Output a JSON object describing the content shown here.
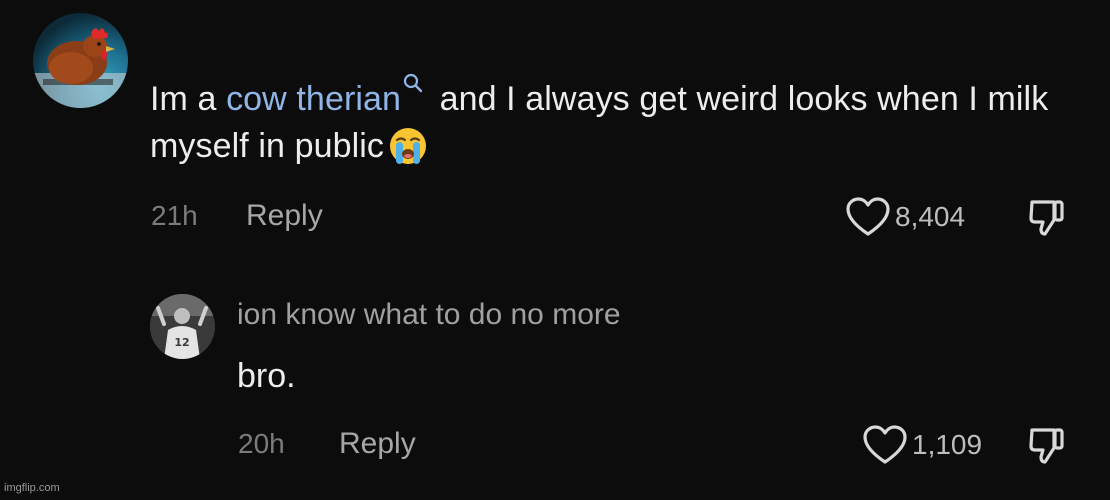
{
  "top_comment": {
    "avatar_icon": "chicken-avatar",
    "text_before": "Im a ",
    "hashtag": "cow therian",
    "text_after": " and I always get weird looks when I milk myself in public",
    "emoji": "loudly-crying-face",
    "time": "21h",
    "reply_label": "Reply",
    "likes": "8,404"
  },
  "reply_comment": {
    "avatar_icon": "person-jersey-avatar",
    "username": "ion know what to do no more",
    "text": "bro.",
    "time": "20h",
    "reply_label": "Reply",
    "likes": "1,109"
  },
  "watermark": "imgflip.com",
  "colors": {
    "background": "#0c0c0c",
    "hashtag_link": "#8fb6e6",
    "primary_text": "#ededed",
    "secondary_text": "#a7a7a7"
  }
}
